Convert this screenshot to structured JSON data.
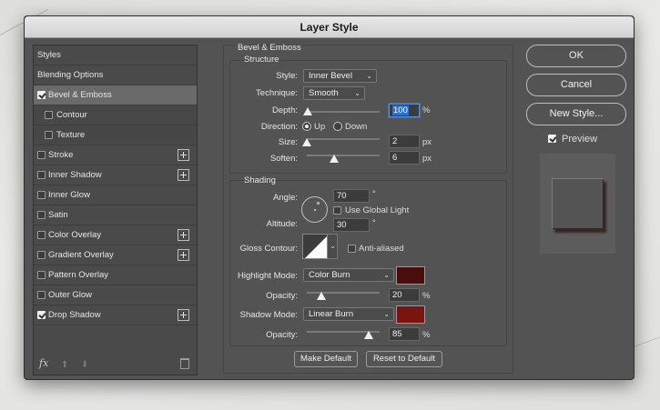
{
  "window": {
    "title": "Layer Style"
  },
  "sidebar": {
    "styles_label": "Styles",
    "blending_label": "Blending Options",
    "items": [
      {
        "label": "Bevel & Emboss",
        "checked": true,
        "selected": true,
        "has_plus": false
      },
      {
        "label": "Contour",
        "checked": false,
        "sub": true
      },
      {
        "label": "Texture",
        "checked": false,
        "sub": true
      },
      {
        "label": "Stroke",
        "checked": false,
        "has_plus": true
      },
      {
        "label": "Inner Shadow",
        "checked": false,
        "has_plus": true
      },
      {
        "label": "Inner Glow",
        "checked": false,
        "has_plus": false
      },
      {
        "label": "Satin",
        "checked": false,
        "has_plus": false
      },
      {
        "label": "Color Overlay",
        "checked": false,
        "has_plus": true
      },
      {
        "label": "Gradient Overlay",
        "checked": false,
        "has_plus": true
      },
      {
        "label": "Pattern Overlay",
        "checked": false,
        "has_plus": false
      },
      {
        "label": "Outer Glow",
        "checked": false,
        "has_plus": false
      },
      {
        "label": "Drop Shadow",
        "checked": true,
        "has_plus": true
      }
    ],
    "fx_label": "fx"
  },
  "bevel": {
    "section_title": "Bevel & Emboss",
    "structure_title": "Structure",
    "style_label": "Style:",
    "style_value": "Inner Bevel",
    "technique_label": "Technique:",
    "technique_value": "Smooth",
    "depth_label": "Depth:",
    "depth_value": "100",
    "depth_unit": "%",
    "depth_level": 0.01,
    "direction_label": "Direction:",
    "direction_up": "Up",
    "direction_down": "Down",
    "size_label": "Size:",
    "size_value": "2",
    "size_unit": "px",
    "size_level": 0.0,
    "soften_label": "Soften:",
    "soften_value": "6",
    "soften_unit": "px",
    "soften_level": 0.375
  },
  "shading": {
    "title": "Shading",
    "angle_label": "Angle:",
    "angle_value": "70",
    "angle_unit": "°",
    "use_global_light": "Use Global Light",
    "altitude_label": "Altitude:",
    "altitude_value": "30",
    "altitude_unit": "°",
    "gloss_label": "Gloss Contour:",
    "anti_aliased": "Anti-aliased",
    "highlight_label": "Highlight Mode:",
    "highlight_mode": "Color Burn",
    "highlight_color": "#4a0d0d",
    "highlight_opacity_label": "Opacity:",
    "highlight_opacity": "20",
    "highlight_opacity_level": 0.2,
    "shadow_label": "Shadow Mode:",
    "shadow_mode": "Linear Burn",
    "shadow_color": "#7a1410",
    "shadow_opacity_label": "Opacity:",
    "shadow_opacity": "85",
    "shadow_opacity_level": 0.85,
    "percent": "%"
  },
  "buttons": {
    "make_default": "Make Default",
    "reset_default": "Reset to Default",
    "ok": "OK",
    "cancel": "Cancel",
    "new_style": "New Style...",
    "preview": "Preview"
  }
}
